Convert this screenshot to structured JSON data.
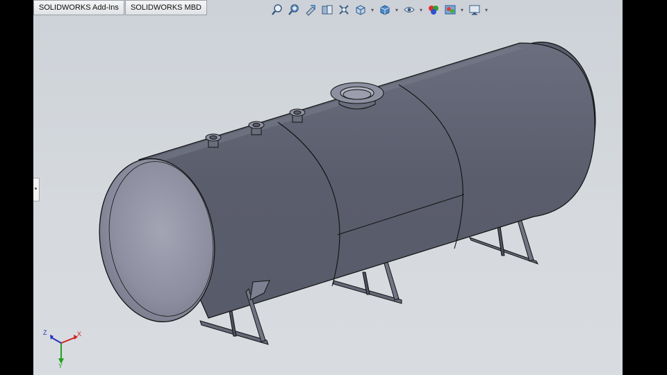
{
  "app": "SOLIDWORKS",
  "tabs": [
    {
      "label": "SOLIDWORKS Add-Ins"
    },
    {
      "label": "SOLIDWORKS MBD"
    }
  ],
  "view_toolbar": {
    "icons": [
      "zoom-to-fit-icon",
      "zoom-to-area-icon",
      "previous-view-icon",
      "section-view-icon",
      "dynamic-annotation-icon",
      "view-orientation-icon",
      "display-style-icon",
      "hide-show-items-icon",
      "edit-appearance-icon",
      "apply-scene-icon",
      "view-settings-icon"
    ]
  },
  "triad": {
    "x": "X",
    "y": "Y",
    "z": "Z"
  },
  "colors": {
    "viewport_bg": "#d4d8dd",
    "tank_body": "#5e6170",
    "tank_head": "#8d8fa0",
    "triad_x": "#d02020",
    "triad_y": "#20a020",
    "triad_z": "#2030c0"
  }
}
